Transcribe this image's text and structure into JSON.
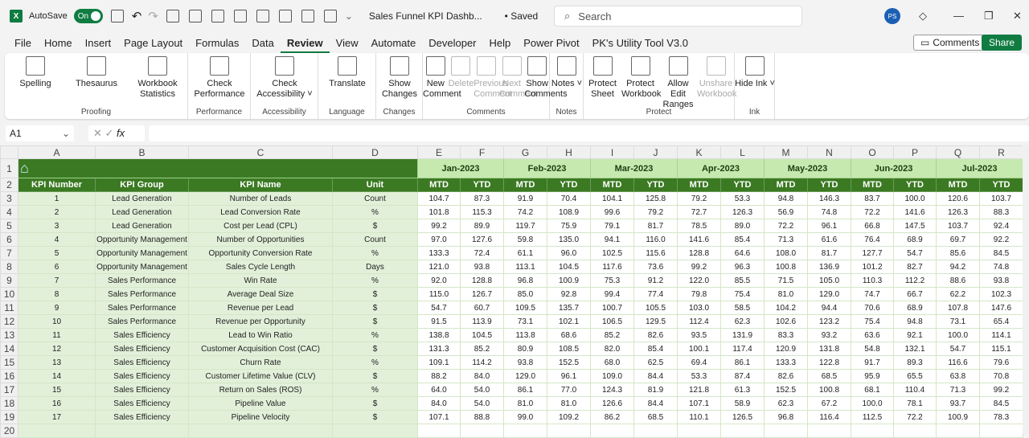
{
  "titlebar": {
    "app_icon": "excel-icon",
    "autosave_label": "AutoSave",
    "autosave_state": "On",
    "doc_title": "Sales Funnel KPI Dashb...",
    "saved_status": "• Saved",
    "search_placeholder": "Search",
    "user_initials": "PS"
  },
  "menu": {
    "tabs": [
      "File",
      "Home",
      "Insert",
      "Page Layout",
      "Formulas",
      "Data",
      "Review",
      "View",
      "Automate",
      "Developer",
      "Help",
      "Power Pivot",
      "PK's Utility Tool V3.0"
    ],
    "active": "Review",
    "comments_label": "Comments",
    "share_label": "Share"
  },
  "ribbon": {
    "groups": [
      {
        "label": "Proofing",
        "buttons": [
          "Spelling",
          "Thesaurus",
          "Workbook Statistics"
        ]
      },
      {
        "label": "Performance",
        "buttons": [
          "Check Performance"
        ]
      },
      {
        "label": "Accessibility",
        "buttons": [
          "Check Accessibility ˅"
        ]
      },
      {
        "label": "Language",
        "buttons": [
          "Translate"
        ]
      },
      {
        "label": "Changes",
        "buttons": [
          "Show Changes"
        ]
      },
      {
        "label": "Comments",
        "buttons": [
          "New Comment",
          "Delete",
          "Previous Comment",
          "Next Comment",
          "Show Comments"
        ]
      },
      {
        "label": "Notes",
        "buttons": [
          "Notes ˅"
        ]
      },
      {
        "label": "Protect",
        "buttons": [
          "Protect Sheet",
          "Protect Workbook",
          "Allow Edit Ranges",
          "Unshare Workbook"
        ]
      },
      {
        "label": "Ink",
        "buttons": [
          "Hide Ink ˅"
        ]
      }
    ]
  },
  "formula_bar": {
    "name_box": "A1",
    "fx": "fx",
    "value": ""
  },
  "sheet": {
    "columns": [
      "A",
      "B",
      "C",
      "D",
      "E",
      "F",
      "G",
      "H",
      "I",
      "J",
      "K",
      "L",
      "M",
      "N",
      "O",
      "P",
      "Q",
      "R"
    ],
    "headers": [
      "KPI Number",
      "KPI Group",
      "KPI Name",
      "Unit"
    ],
    "months": [
      "Jan-2023",
      "Feb-2023",
      "Mar-2023",
      "Apr-2023",
      "May-2023",
      "Jun-2023",
      "Jul-2023"
    ],
    "sub": [
      "MTD",
      "YTD"
    ],
    "colors": {
      "dark_green": "#3b7a23",
      "light_green": "#e2f0d9",
      "month_green": "#c6e9b0"
    },
    "rows": [
      {
        "n": "1",
        "g": "Lead Generation",
        "k": "Number of Leads",
        "u": "Count",
        "v": [
          "104.7",
          "87.3",
          "91.9",
          "70.4",
          "104.1",
          "125.8",
          "79.2",
          "53.3",
          "94.8",
          "146.3",
          "83.7",
          "100.0",
          "120.6",
          "103.7"
        ]
      },
      {
        "n": "2",
        "g": "Lead Generation",
        "k": "Lead Conversion Rate",
        "u": "%",
        "v": [
          "101.8",
          "115.3",
          "74.2",
          "108.9",
          "99.6",
          "79.2",
          "72.7",
          "126.3",
          "56.9",
          "74.8",
          "72.2",
          "141.6",
          "126.3",
          "88.3"
        ]
      },
      {
        "n": "3",
        "g": "Lead Generation",
        "k": "Cost per Lead (CPL)",
        "u": "$",
        "v": [
          "99.2",
          "89.9",
          "119.7",
          "75.9",
          "79.1",
          "81.7",
          "78.5",
          "89.0",
          "72.2",
          "96.1",
          "66.8",
          "147.5",
          "103.7",
          "92.4"
        ]
      },
      {
        "n": "4",
        "g": "Opportunity Management",
        "k": "Number of Opportunities",
        "u": "Count",
        "v": [
          "97.0",
          "127.6",
          "59.8",
          "135.0",
          "94.1",
          "116.0",
          "141.6",
          "85.4",
          "71.3",
          "61.6",
          "76.4",
          "68.9",
          "69.7",
          "92.2"
        ]
      },
      {
        "n": "5",
        "g": "Opportunity Management",
        "k": "Opportunity Conversion Rate",
        "u": "%",
        "v": [
          "133.3",
          "72.4",
          "61.1",
          "96.0",
          "102.5",
          "115.6",
          "128.8",
          "64.6",
          "108.0",
          "81.7",
          "127.7",
          "54.7",
          "85.6",
          "84.5"
        ]
      },
      {
        "n": "6",
        "g": "Opportunity Management",
        "k": "Sales Cycle Length",
        "u": "Days",
        "v": [
          "121.0",
          "93.8",
          "113.1",
          "104.5",
          "117.6",
          "73.6",
          "99.2",
          "96.3",
          "100.8",
          "136.9",
          "101.2",
          "82.7",
          "94.2",
          "74.8"
        ]
      },
      {
        "n": "7",
        "g": "Sales Performance",
        "k": "Win Rate",
        "u": "%",
        "v": [
          "92.0",
          "128.8",
          "96.8",
          "100.9",
          "75.3",
          "91.2",
          "122.0",
          "85.5",
          "71.5",
          "105.0",
          "110.3",
          "112.2",
          "88.6",
          "93.8"
        ]
      },
      {
        "n": "8",
        "g": "Sales Performance",
        "k": "Average Deal Size",
        "u": "$",
        "v": [
          "115.0",
          "126.7",
          "85.0",
          "92.8",
          "99.4",
          "77.4",
          "79.8",
          "75.4",
          "81.0",
          "129.0",
          "74.7",
          "66.7",
          "62.2",
          "102.3"
        ]
      },
      {
        "n": "9",
        "g": "Sales Performance",
        "k": "Revenue per Lead",
        "u": "$",
        "v": [
          "54.7",
          "60.7",
          "109.5",
          "135.7",
          "100.7",
          "105.5",
          "103.0",
          "58.5",
          "104.2",
          "94.4",
          "70.6",
          "68.9",
          "107.8",
          "147.6"
        ]
      },
      {
        "n": "10",
        "g": "Sales Performance",
        "k": "Revenue per Opportunity",
        "u": "$",
        "v": [
          "91.5",
          "113.9",
          "73.1",
          "102.1",
          "106.5",
          "129.5",
          "112.4",
          "62.3",
          "102.6",
          "123.2",
          "75.4",
          "94.8",
          "73.1",
          "65.4"
        ]
      },
      {
        "n": "11",
        "g": "Sales Efficiency",
        "k": "Lead to Win Ratio",
        "u": "%",
        "v": [
          "138.8",
          "104.5",
          "113.8",
          "68.6",
          "85.2",
          "82.6",
          "93.5",
          "131.9",
          "83.3",
          "93.2",
          "63.6",
          "92.1",
          "100.0",
          "114.1"
        ]
      },
      {
        "n": "12",
        "g": "Sales Efficiency",
        "k": "Customer Acquisition Cost (CAC)",
        "u": "$",
        "v": [
          "131.3",
          "85.2",
          "80.9",
          "108.5",
          "82.0",
          "85.4",
          "100.1",
          "117.4",
          "120.9",
          "131.8",
          "54.8",
          "132.1",
          "54.7",
          "115.1"
        ]
      },
      {
        "n": "13",
        "g": "Sales Efficiency",
        "k": "Churn Rate",
        "u": "%",
        "v": [
          "109.1",
          "114.2",
          "93.8",
          "152.5",
          "68.0",
          "62.5",
          "69.4",
          "86.1",
          "133.3",
          "122.8",
          "91.7",
          "89.3",
          "116.6",
          "79.6"
        ]
      },
      {
        "n": "14",
        "g": "Sales Efficiency",
        "k": "Customer Lifetime Value (CLV)",
        "u": "$",
        "v": [
          "88.2",
          "84.0",
          "129.0",
          "96.1",
          "109.0",
          "84.4",
          "53.3",
          "87.4",
          "82.6",
          "68.5",
          "95.9",
          "65.5",
          "63.8",
          "70.8"
        ]
      },
      {
        "n": "15",
        "g": "Sales Efficiency",
        "k": "Return on Sales (ROS)",
        "u": "%",
        "v": [
          "64.0",
          "54.0",
          "86.1",
          "77.0",
          "124.3",
          "81.9",
          "121.8",
          "61.3",
          "152.5",
          "100.8",
          "68.1",
          "110.4",
          "71.3",
          "99.2"
        ]
      },
      {
        "n": "16",
        "g": "Sales Efficiency",
        "k": "Pipeline Value",
        "u": "$",
        "v": [
          "84.0",
          "54.0",
          "81.0",
          "81.0",
          "126.6",
          "84.4",
          "107.1",
          "58.9",
          "62.3",
          "67.2",
          "100.0",
          "78.1",
          "93.7",
          "84.5"
        ]
      },
      {
        "n": "17",
        "g": "Sales Efficiency",
        "k": "Pipeline Velocity",
        "u": "$",
        "v": [
          "107.1",
          "88.8",
          "99.0",
          "109.2",
          "86.2",
          "68.5",
          "110.1",
          "126.5",
          "96.8",
          "116.4",
          "112.5",
          "72.2",
          "100.9",
          "78.3"
        ]
      }
    ]
  }
}
